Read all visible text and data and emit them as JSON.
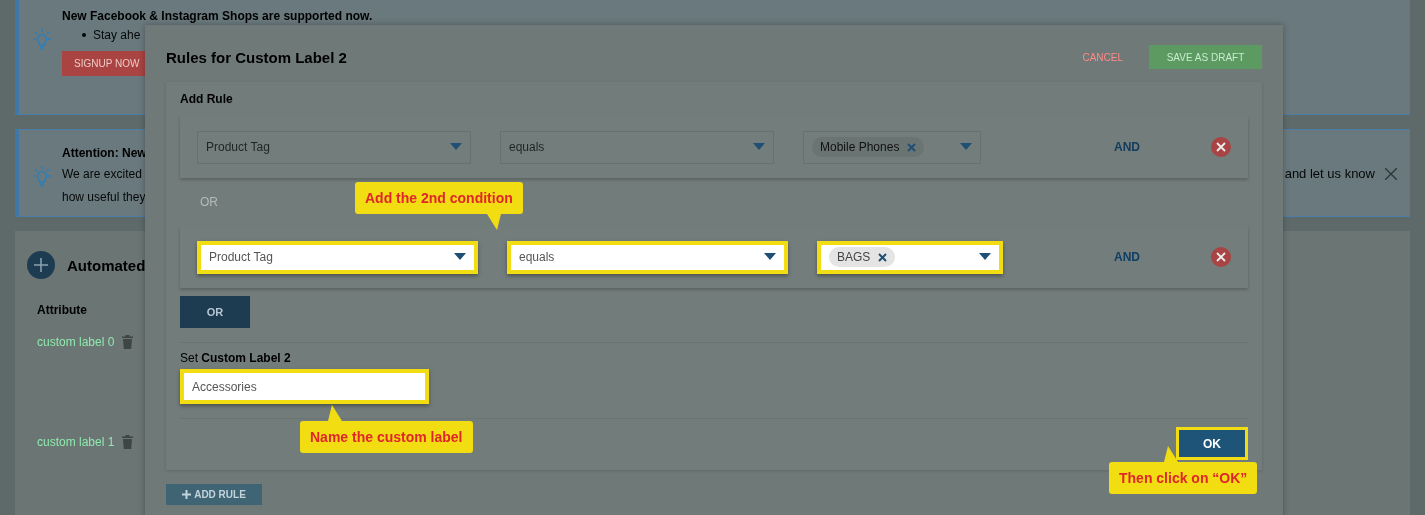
{
  "background_page": {
    "notices": [
      {
        "title": "New Facebook & Instagram Shops are supported now.",
        "bullets": [
          "Stay ahe"
        ],
        "button": "SIGNUP NOW",
        "closable": false
      },
      {
        "title": "Attention: New",
        "lines": [
          "We are excited",
          "how useful they"
        ],
        "trailing_text": "and let us know",
        "closable": true
      }
    ],
    "automation_card": {
      "title": "Automated",
      "column_header": "Attribute",
      "rows": [
        "custom label 0",
        "custom label 1"
      ]
    }
  },
  "dialog": {
    "title": "Rules for Custom Label 2",
    "cancel": "CANCEL",
    "save_draft": "SAVE AS DRAFT",
    "section_title": "Add Rule",
    "conditions": [
      {
        "attribute": "Product Tag",
        "operator": "equals",
        "values": [
          "Mobile Phones"
        ],
        "join": "AND",
        "highlighted": false
      },
      {
        "attribute": "Product Tag",
        "operator": "equals",
        "values": [
          "BAGS"
        ],
        "join": "AND",
        "highlighted": true
      }
    ],
    "or_separator": "OR",
    "or_button": "OR",
    "label_prompt": "Set **Custom Label 2**",
    "label_value": "Accessories",
    "label_highlighted": true,
    "ok": "OK",
    "ok_highlighted": true,
    "add_rule": "ADD RULE"
  },
  "callouts": [
    {
      "text": "Add the 2nd condition",
      "kind": "pointer_down"
    },
    {
      "text": "Name the custom label",
      "kind": "pointer_up"
    },
    {
      "text": "Then click on “OK”",
      "kind": "pointer_up"
    }
  ]
}
